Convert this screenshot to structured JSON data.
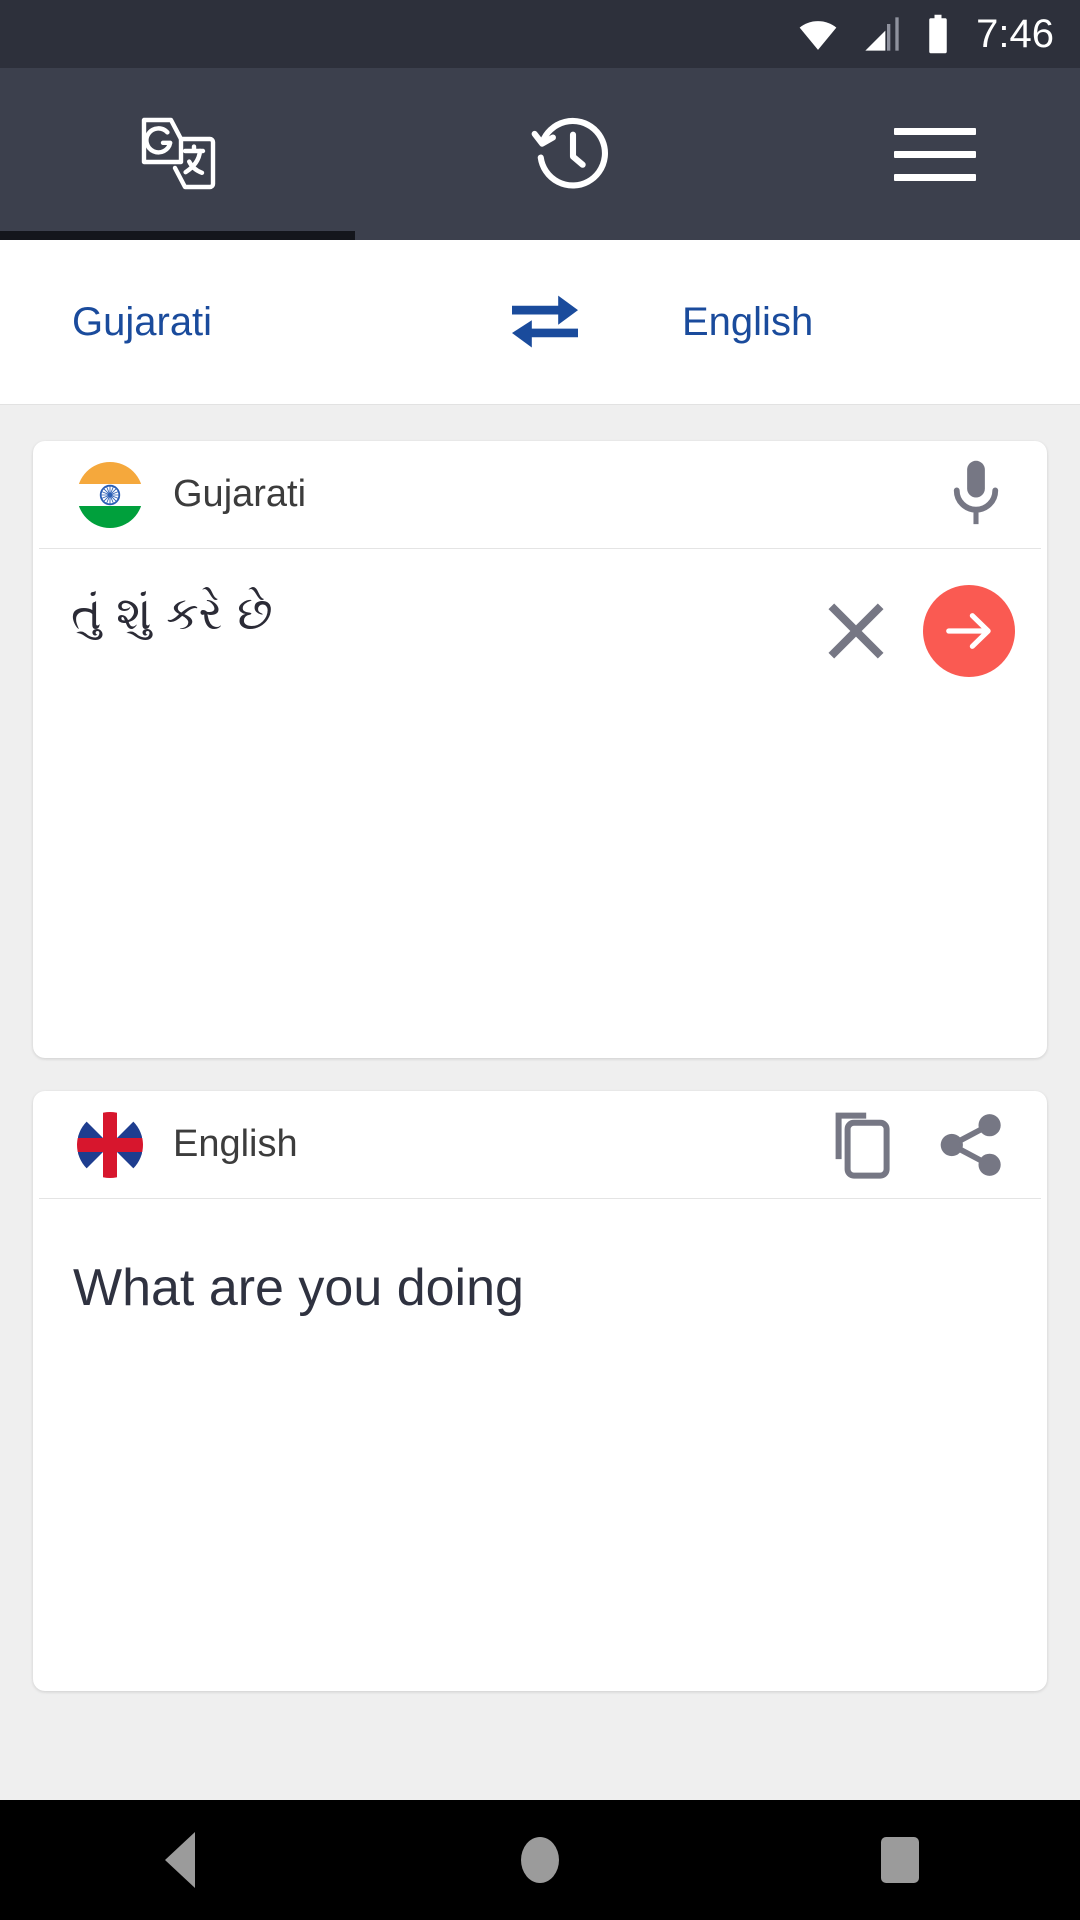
{
  "status_bar": {
    "time": "7:46",
    "icons": [
      "wifi-icon",
      "cellular-signal-icon",
      "battery-icon"
    ]
  },
  "toolbar": {
    "translate_tab": "translate-tab",
    "history_tab": "history-tab",
    "menu_button": "menu-button",
    "active_tab": "translate-tab"
  },
  "language_bar": {
    "source_language": "Gujarati",
    "target_language": "English",
    "swap_label": "swap-languages",
    "text_color": "#1a4b9c"
  },
  "source_card": {
    "language": "Gujarati",
    "flag": "india-flag",
    "mic_label": "microphone",
    "input_text": "તું શું કરે છે",
    "clear_label": "clear-text",
    "submit_label": "translate",
    "submit_color": "#fa5a52"
  },
  "target_card": {
    "language": "English",
    "flag": "uk-flag",
    "copy_label": "copy-translation",
    "share_label": "share-translation",
    "result_text": "What are you doing"
  },
  "nav_bar": {
    "back": "back-button",
    "home": "home-button",
    "recents": "recents-button"
  }
}
